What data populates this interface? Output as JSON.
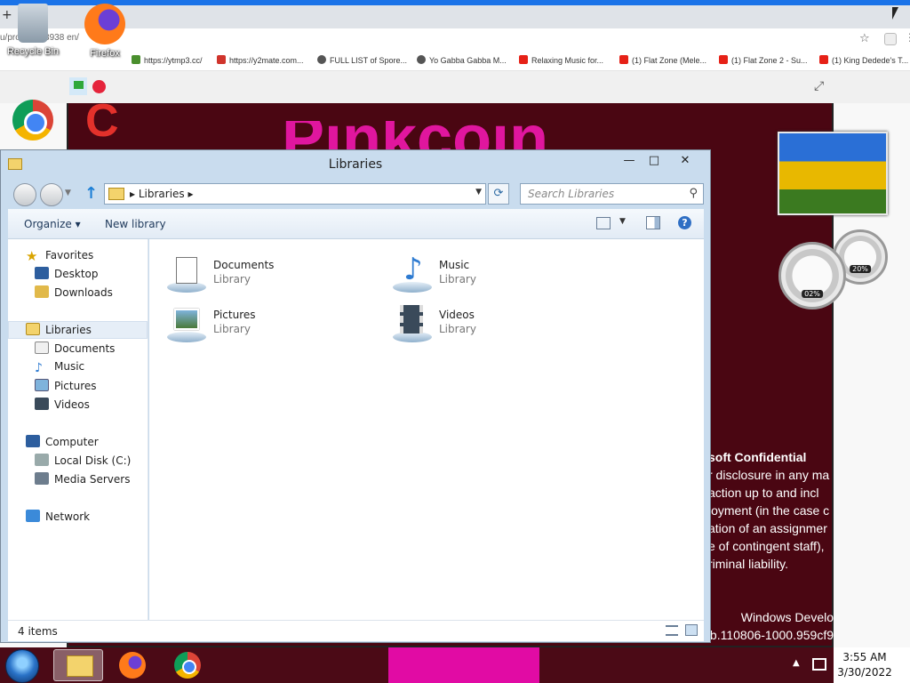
{
  "browser": {
    "new_tab": "+",
    "address": "u/proj        53948938       en/",
    "bookmarks": [
      "https://ytmp3.cc/",
      "https://y2mate.com...",
      "FULL LIST of Spore...",
      "Yo Gabba Gabba M...",
      "Relaxing Music for...",
      "(1) Flat Zone (Mele...",
      "(1) Flat Zone 2 - Su...",
      "(1) King Dedede's T..."
    ],
    "stage_title": "Pinkcoin",
    "confidential_lines": [
      "soft Confidential",
      "r disclosure in any ma",
      " action up to and incl",
      "loyment (in the case c",
      "ation of an assignmer",
      "e of contingent staff),",
      "riminal liability."
    ],
    "windows_version": [
      "Windows Develo",
      "b.110806-1000.959cf9"
    ]
  },
  "desktop": {
    "icons": [
      {
        "label": "Recycle Bin"
      },
      {
        "label": "Firefox"
      },
      {
        "label": "Chrome"
      },
      {
        "label": "CCl"
      }
    ],
    "gauge_cpu": "02%",
    "gauge_mem": "20%"
  },
  "explorer": {
    "title": "Libraries",
    "address_crumb": "Libraries",
    "search_placeholder": "Search Libraries",
    "commands": {
      "organize": "Organize ▾",
      "new_library": "New library"
    },
    "nav": {
      "favorites": "Favorites",
      "favorites_items": [
        "Desktop",
        "Downloads"
      ],
      "libraries": "Libraries",
      "libraries_items": [
        "Documents",
        "Music",
        "Pictures",
        "Videos"
      ],
      "computer": "Computer",
      "computer_items": [
        "Local Disk (C:)",
        "Media Servers"
      ],
      "network": "Network"
    },
    "libraries": [
      {
        "name": "Documents",
        "type": "Library"
      },
      {
        "name": "Music",
        "type": "Library"
      },
      {
        "name": "Pictures",
        "type": "Library"
      },
      {
        "name": "Videos",
        "type": "Library"
      }
    ],
    "status": "4 items"
  },
  "taskbar": {
    "time": "3:55 AM",
    "date": "3/30/2022"
  }
}
